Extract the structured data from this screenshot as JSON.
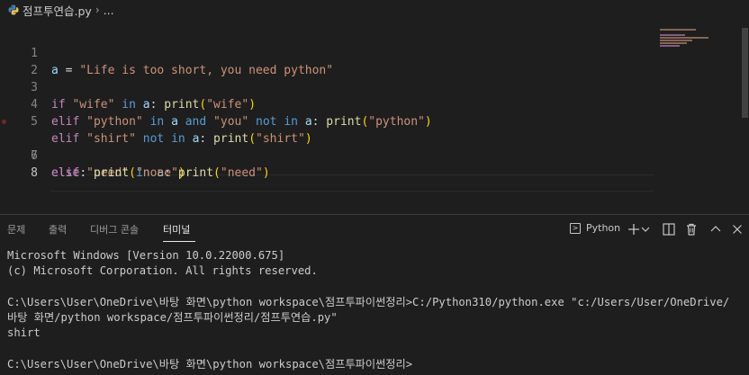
{
  "breadcrumb": {
    "file": "점프투연습.py",
    "separator": "›",
    "symbol": "..."
  },
  "editor": {
    "lines": [
      {
        "num": "1"
      },
      {
        "num": "2"
      },
      {
        "num": "3"
      },
      {
        "num": "4"
      },
      {
        "num": "5"
      },
      {
        "num": "6"
      },
      {
        "num": "7"
      },
      {
        "num": "8"
      }
    ]
  },
  "panel": {
    "tabs": [
      {
        "label": "문제"
      },
      {
        "label": "출력"
      },
      {
        "label": "디버그 콘솔"
      },
      {
        "label": "터미널"
      }
    ],
    "terminal_profile": "Python"
  },
  "terminal": {
    "lines": [
      "Microsoft Windows [Version 10.0.22000.675]",
      "(c) Microsoft Corporation. All rights reserved.",
      "",
      "C:\\Users\\User\\OneDrive\\바탕 화면\\python workspace\\점프투파이썬정리>C:/Python310/python.exe \"c:/Users/User/OneDrive/",
      "바탕 화면/python workspace/점프투파이썬정리/점프투연습.py\"",
      "shirt",
      "",
      "C:\\Users\\User\\OneDrive\\바탕 화면\\python workspace\\점프투파이썬정리>"
    ]
  },
  "colors": {
    "background": "#1e1e1e",
    "string": "#ce9178",
    "keyword": "#c586c0",
    "function": "#dcdcaa",
    "variable": "#9cdcfe",
    "bracket": "#ffd700"
  }
}
